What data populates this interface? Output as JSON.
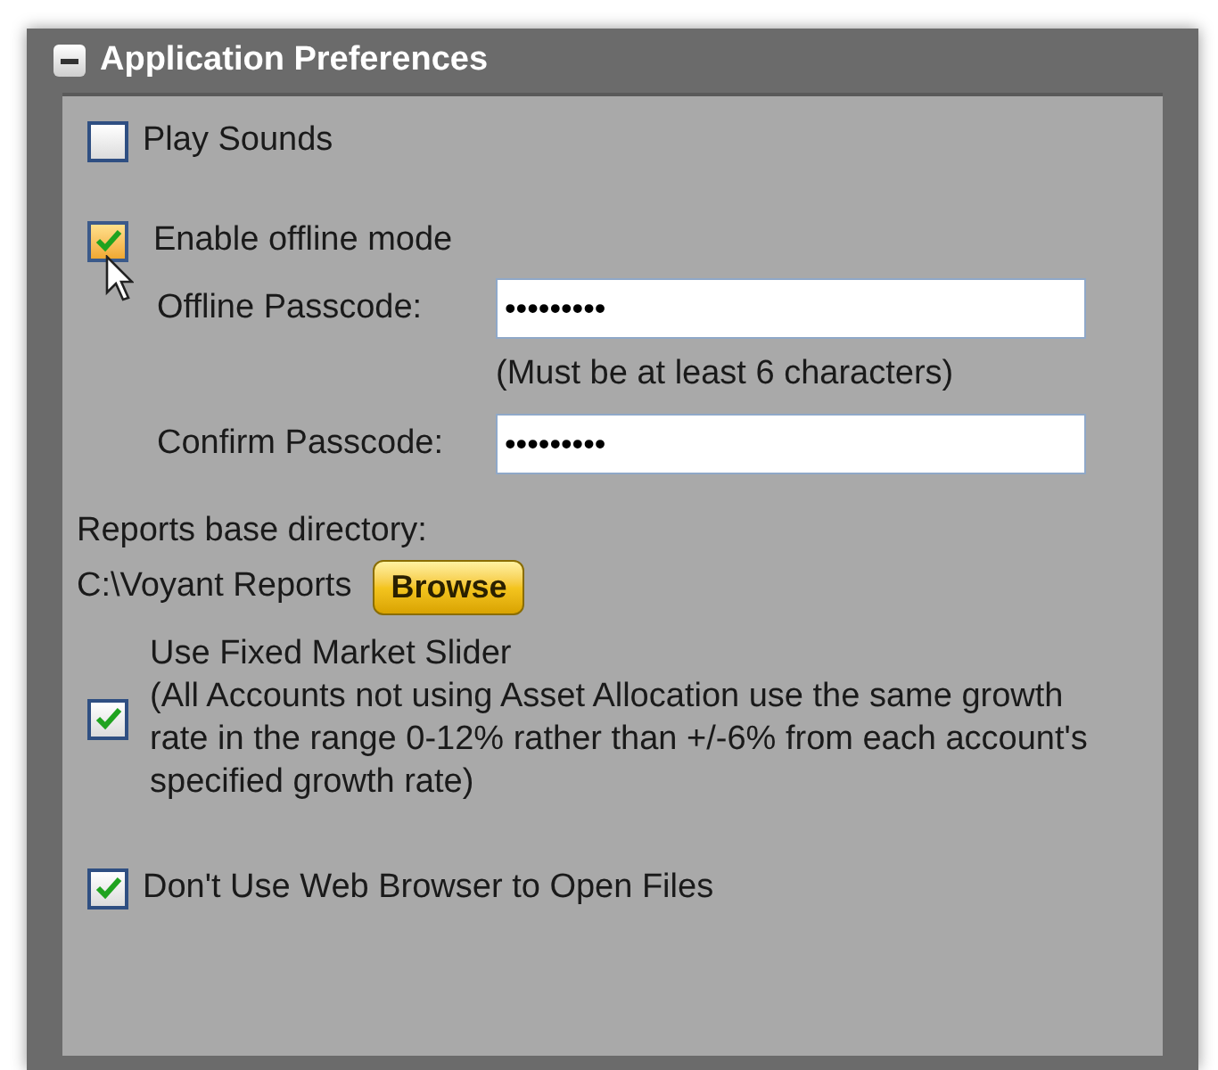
{
  "panel": {
    "title": "Application Preferences",
    "expanded": true
  },
  "play_sounds": {
    "label": "Play Sounds",
    "checked": false
  },
  "offline_mode": {
    "label": "Enable offline mode",
    "checked": true,
    "hovered": true
  },
  "offline_passcode": {
    "label": "Offline Passcode:",
    "value": "•••••••••",
    "hint": "(Must be at least 6 characters)"
  },
  "confirm_passcode": {
    "label": "Confirm Passcode:",
    "value": "•••••••••"
  },
  "reports": {
    "label": "Reports base directory:",
    "path": "C:\\Voyant Reports",
    "button": "Browse"
  },
  "fixed_market": {
    "title": "Use Fixed Market Slider",
    "description": "(All Accounts not using Asset Allocation use the same growth rate in the range 0-12% rather than +/-6% from each account's specified growth rate)",
    "checked": true
  },
  "web_browser": {
    "label": "Don't Use Web Browser to Open Files",
    "checked": true
  }
}
